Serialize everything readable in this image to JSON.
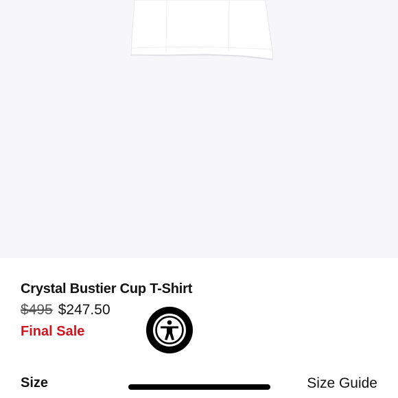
{
  "product": {
    "name": "Crystal Bustier Cup T-Shirt",
    "price_original": "$495",
    "price_sale": "$247.50",
    "sale_badge": "Final Sale"
  },
  "size_section": {
    "label": "Size",
    "guide_link": "Size Guide"
  },
  "icons": {
    "accessibility": "accessibility-person-icon"
  },
  "colors": {
    "hero_background": "#f7f7f9",
    "sale_red": "#d0131c",
    "text": "#111111"
  }
}
